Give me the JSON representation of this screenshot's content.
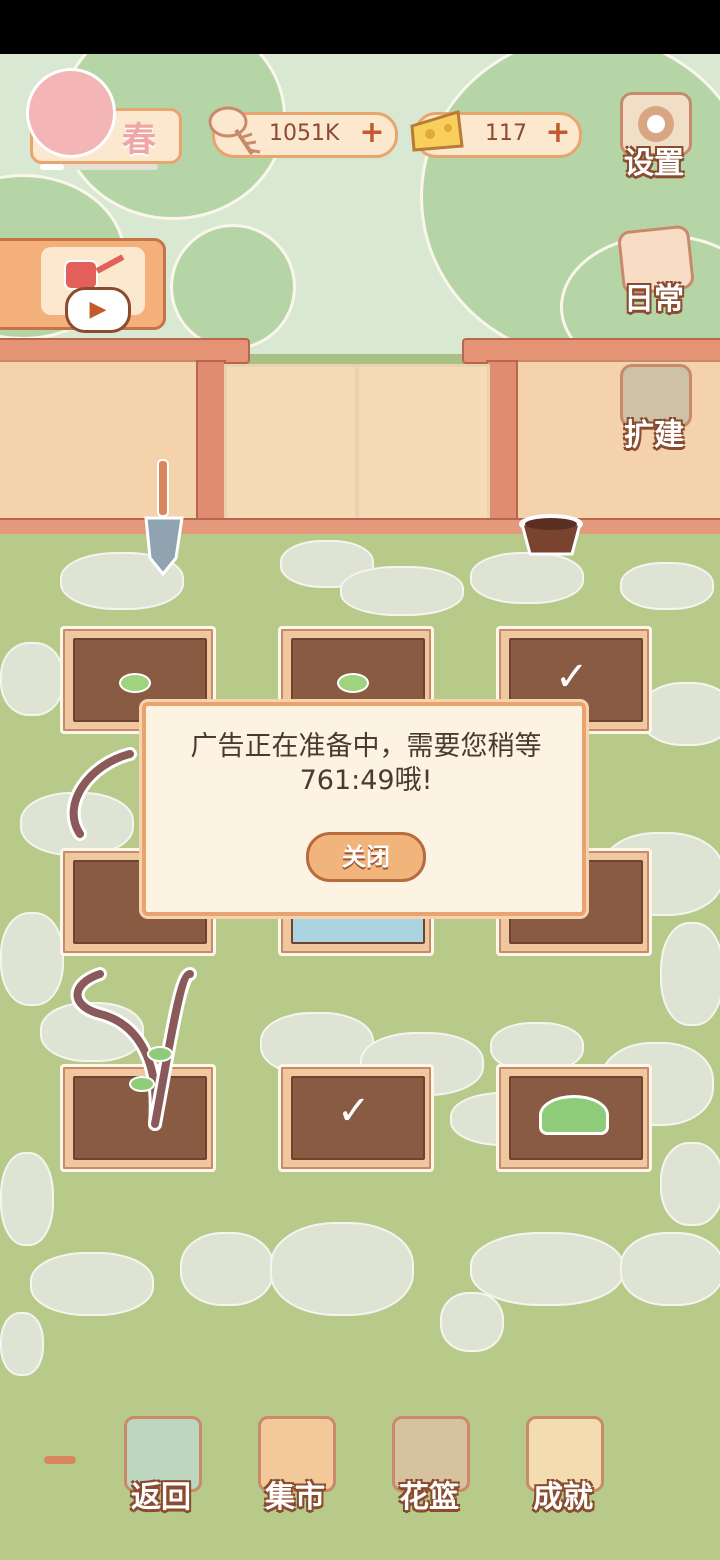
{
  "hud": {
    "season_label": "春",
    "fish_currency": "1051K",
    "cheese_currency": "117",
    "settings_label": "设置",
    "daily_label": "日常",
    "expand_label": "扩建"
  },
  "dialog": {
    "message": "广告正在准备中，需要您稍等761:49哦!",
    "close_label": "关闭"
  },
  "bottom_nav": {
    "back": "返回",
    "market": "集市",
    "basket": "花篮",
    "achievements": "成就"
  },
  "colors": {
    "accent": "#e9a36f",
    "label_outline": "#8a4b2f",
    "grass": "#b7ca8a",
    "soil": "#8a5b43"
  }
}
